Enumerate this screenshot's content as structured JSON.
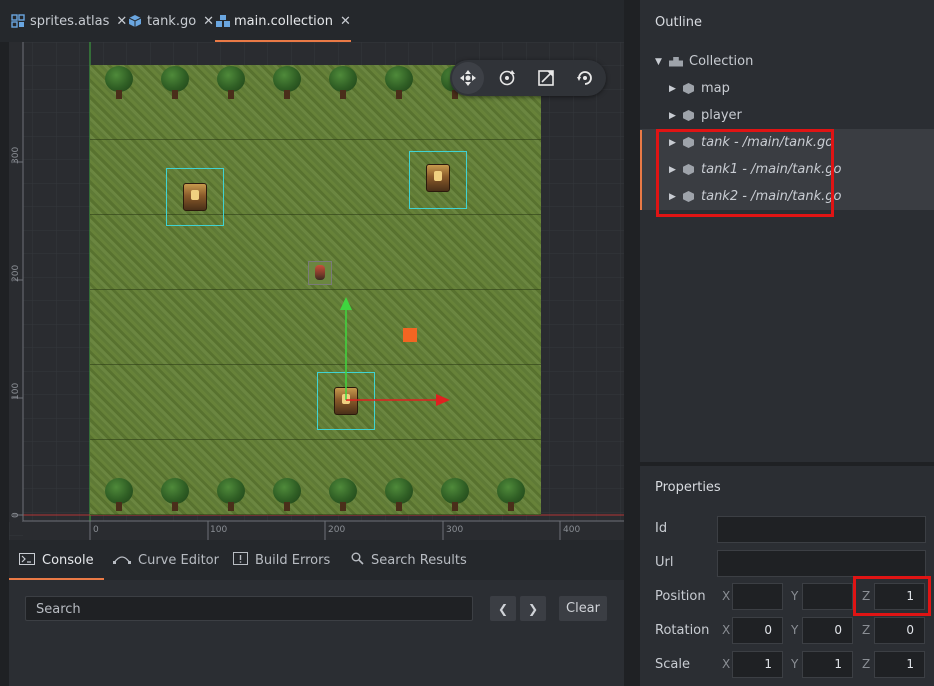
{
  "tabs": [
    {
      "label": "sprites.atlas",
      "icon": "atlas-icon"
    },
    {
      "label": "tank.go",
      "icon": "cube-icon"
    },
    {
      "label": "main.collection",
      "icon": "collection-icon",
      "active": true
    }
  ],
  "viewport": {
    "y_ruler": [
      "300",
      "200",
      "100",
      "0"
    ],
    "x_ruler": [
      "0",
      "100",
      "200",
      "300",
      "400"
    ],
    "tools": [
      "move-tool-icon",
      "rotate-tool-icon",
      "scale-tool-icon",
      "camera-reset-icon"
    ]
  },
  "bottom_tabs": [
    {
      "label": "Console",
      "icon": "console-icon",
      "active": true
    },
    {
      "label": "Curve Editor",
      "icon": "curve-icon"
    },
    {
      "label": "Build Errors",
      "icon": "alert-icon"
    },
    {
      "label": "Search Results",
      "icon": "search-icon"
    }
  ],
  "console": {
    "search_placeholder": "Search",
    "prev_label": "❮",
    "next_label": "❯",
    "clear_label": "Clear"
  },
  "outline": {
    "title": "Outline",
    "root": "Collection",
    "items": [
      {
        "label": "map"
      },
      {
        "label": "player"
      },
      {
        "label": "tank - /main/tank.go",
        "selected": true
      },
      {
        "label": "tank1 - /main/tank.go",
        "selected": true
      },
      {
        "label": "tank2 - /main/tank.go",
        "selected": true
      }
    ]
  },
  "properties": {
    "title": "Properties",
    "id_label": "Id",
    "url_label": "Url",
    "id_value": "",
    "url_value": "",
    "position": {
      "label": "Position",
      "x": "",
      "y": "",
      "z": "1"
    },
    "rotation": {
      "label": "Rotation",
      "x": "0",
      "y": "0",
      "z": "0"
    },
    "scale": {
      "label": "Scale",
      "x": "1",
      "y": "1",
      "z": "1"
    },
    "axis_x": "X",
    "axis_y": "Y",
    "axis_z": "Z"
  },
  "colors": {
    "accent": "#ea7a46",
    "highlight": "#e01414",
    "selection": "#3fd3d3"
  }
}
